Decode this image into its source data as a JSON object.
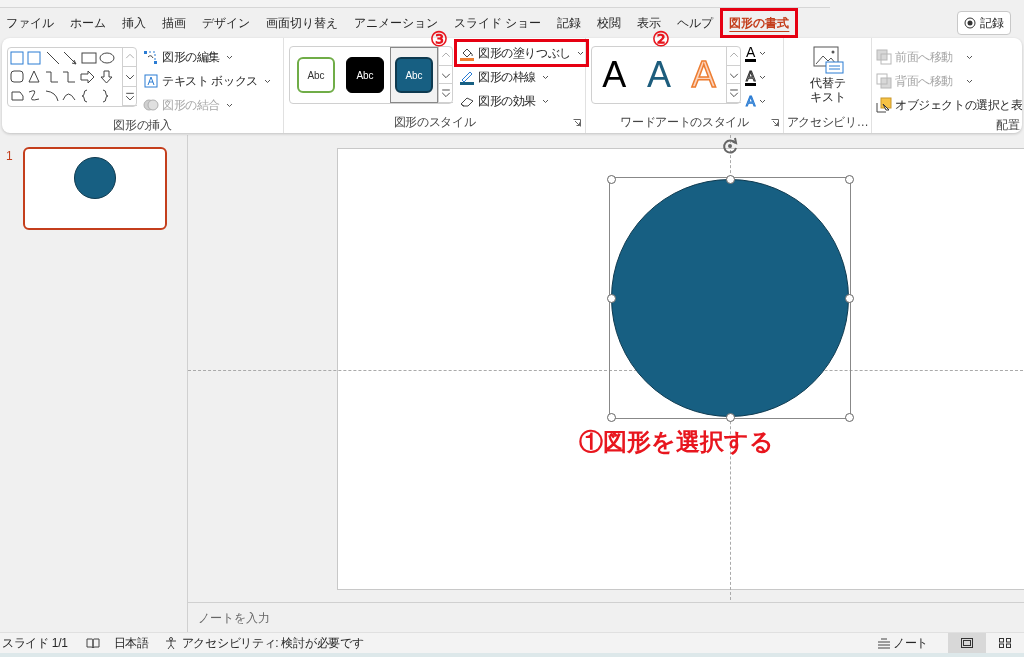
{
  "tabs": [
    {
      "label": "ファイル",
      "selected": false,
      "highlighted": false
    },
    {
      "label": "ホーム",
      "selected": false,
      "highlighted": false
    },
    {
      "label": "挿入",
      "selected": false,
      "highlighted": false
    },
    {
      "label": "描画",
      "selected": false,
      "highlighted": false
    },
    {
      "label": "デザイン",
      "selected": false,
      "highlighted": false
    },
    {
      "label": "画面切り替え",
      "selected": false,
      "highlighted": false
    },
    {
      "label": "アニメーション",
      "selected": false,
      "highlighted": false
    },
    {
      "label": "スライド ショー",
      "selected": false,
      "highlighted": false
    },
    {
      "label": "記録",
      "selected": false,
      "highlighted": false
    },
    {
      "label": "校閲",
      "selected": false,
      "highlighted": false
    },
    {
      "label": "表示",
      "selected": false,
      "highlighted": false
    },
    {
      "label": "ヘルプ",
      "selected": false,
      "highlighted": false
    },
    {
      "label": "図形の書式",
      "selected": true,
      "highlighted": true
    }
  ],
  "record_button": "記録",
  "ribbon": {
    "insert_shapes": {
      "label": "図形の挿入",
      "commands": [
        {
          "label": "図形の編集",
          "disabled": false
        },
        {
          "label": "テキスト ボックス",
          "disabled": false
        },
        {
          "label": "図形の結合",
          "disabled": true
        }
      ]
    },
    "shape_styles": {
      "label": "図形のスタイル",
      "presets": [
        {
          "label": "Abc",
          "kind": "outline",
          "selected": false
        },
        {
          "label": "Abc",
          "kind": "dark",
          "selected": false
        },
        {
          "label": "Abc",
          "kind": "fill",
          "selected": true
        }
      ],
      "commands": [
        {
          "label": "図形の塗りつぶし",
          "highlighted": true
        },
        {
          "label": "図形の枠線",
          "highlighted": false
        },
        {
          "label": "図形の効果",
          "highlighted": false
        }
      ]
    },
    "wordart_styles": {
      "label": "ワードアートのスタイル",
      "presets": [
        {
          "label": "A",
          "kind": "plain"
        },
        {
          "label": "A",
          "kind": "fill"
        },
        {
          "label": "A",
          "kind": "outline"
        }
      ],
      "text_tools": [
        {
          "label": "A",
          "kind": "fill"
        },
        {
          "label": "A",
          "kind": "outline"
        },
        {
          "label": "A",
          "kind": "effect"
        }
      ]
    },
    "accessibility": {
      "label": "アクセシビリ…",
      "command": "代替テキスト"
    },
    "arrange": {
      "label": "配置",
      "commands": [
        {
          "label": "前面へ移動",
          "disabled": true
        },
        {
          "label": "背面へ移動",
          "disabled": true
        },
        {
          "label": "オブジェクトの選択と表",
          "disabled": false
        }
      ]
    }
  },
  "slides": [
    {
      "number": "1",
      "selected": true
    }
  ],
  "slide": {
    "shape": {
      "kind": "circle",
      "color": "#175f82",
      "selected": true
    }
  },
  "annotations": [
    {
      "label": "①図形を選択する"
    },
    {
      "label": "②"
    },
    {
      "label": "③"
    }
  ],
  "notes": {
    "placeholder": "ノートを入力"
  },
  "status_bar": {
    "slide": "スライド 1/1",
    "language": "日本語",
    "accessibility": "アクセシビリティ: 検討が必要です",
    "notes_button": "ノート",
    "views": [
      {
        "kind": "normal",
        "selected": true
      },
      {
        "kind": "sorter",
        "selected": false
      }
    ]
  }
}
